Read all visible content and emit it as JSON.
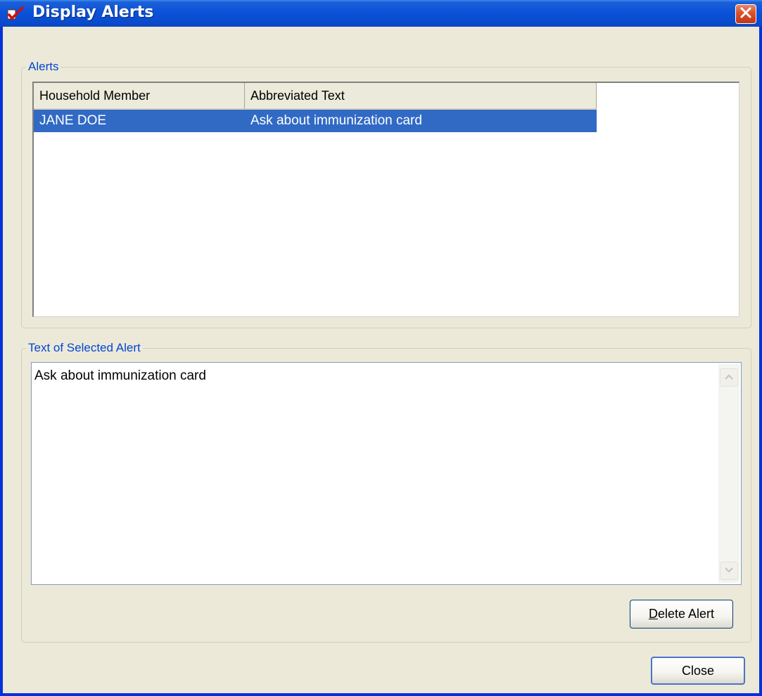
{
  "window": {
    "title": "Display Alerts",
    "accent": "#0a52d8",
    "selection_color": "#316ac5"
  },
  "alerts_group": {
    "legend": "Alerts",
    "columns": [
      "Household Member",
      "Abbreviated Text"
    ],
    "rows": [
      {
        "member": "JANE DOE",
        "text": "Ask about immunization card",
        "selected": true
      }
    ]
  },
  "selected_alert_group": {
    "legend": "Text of Selected Alert",
    "text": "Ask about immunization card"
  },
  "buttons": {
    "delete_mnemonic": "D",
    "delete_rest": "elete Alert",
    "close": "Close"
  },
  "icons": {
    "app": "checkmark-app-icon",
    "close": "close-icon",
    "scroll_up": "chevron-up-icon",
    "scroll_down": "chevron-down-icon"
  }
}
